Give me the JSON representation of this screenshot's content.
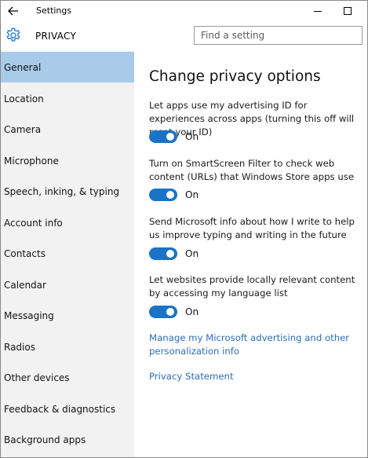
{
  "window": {
    "title": "Settings"
  },
  "header": {
    "title": "PRIVACY",
    "search_placeholder": "Find a setting"
  },
  "sidebar": {
    "items": [
      {
        "label": "General",
        "active": true
      },
      {
        "label": "Location",
        "active": false
      },
      {
        "label": "Camera",
        "active": false
      },
      {
        "label": "Microphone",
        "active": false
      },
      {
        "label": "Speech, inking, & typing",
        "active": false
      },
      {
        "label": "Account info",
        "active": false
      },
      {
        "label": "Contacts",
        "active": false
      },
      {
        "label": "Calendar",
        "active": false
      },
      {
        "label": "Messaging",
        "active": false
      },
      {
        "label": "Radios",
        "active": false
      },
      {
        "label": "Other devices",
        "active": false
      },
      {
        "label": "Feedback & diagnostics",
        "active": false
      },
      {
        "label": "Background apps",
        "active": false
      }
    ]
  },
  "content": {
    "title": "Change privacy options",
    "settings": [
      {
        "description": "Let apps use my advertising ID for experiences across apps (turning this off will reset your ID)",
        "state": "On"
      },
      {
        "description": "Turn on SmartScreen Filter to check web content (URLs) that Windows Store apps use",
        "state": "On"
      },
      {
        "description": "Send Microsoft info about how I write to help us improve typing and writing in the future",
        "state": "On"
      },
      {
        "description": "Let websites provide locally relevant content by accessing my language list",
        "state": "On"
      }
    ],
    "links": [
      {
        "label": "Manage my Microsoft advertising and other personalization info"
      },
      {
        "label": "Privacy Statement"
      }
    ]
  },
  "colors": {
    "accent": "#1a73c7",
    "sidebar_active": "#a9cbea",
    "sidebar_bg": "#f2f2f2",
    "link": "#2a6ebb"
  },
  "icons": {
    "back": "back-arrow-icon",
    "gear": "gear-icon",
    "minimize": "minimize-icon",
    "maximize": "maximize-icon"
  }
}
